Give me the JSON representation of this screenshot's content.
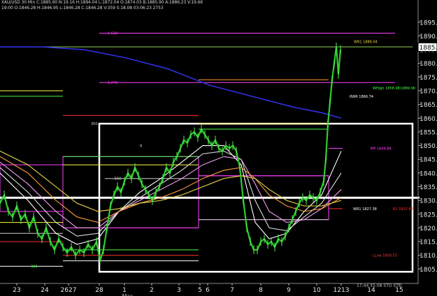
{
  "header": {
    "line1": "XAU/USD 30 Min  C:1885.90  N:19.16  H:1894.04  L:1872.04  O:1874.03  B:1885.90  A:1886.23  V:19.6K",
    "line2": "19:00  O:1846.28  H:1846.95  L:1846.28  C:1846.28  V:359  S:18.08  03:06:23  2753"
  },
  "chart_data": {
    "type": "line",
    "title": "XAU/USD 30 Min",
    "xlabel": "",
    "ylabel": "",
    "ylim": [
      1800,
      1898
    ],
    "grid": false,
    "x_ticks": [
      {
        "label": "23",
        "pos": 24
      },
      {
        "label": "24",
        "pos": 64
      },
      {
        "label": "2627",
        "pos": 98
      },
      {
        "label": "28",
        "pos": 142
      },
      {
        "label": "1",
        "pos": 178
      },
      {
        "label": "2",
        "pos": 217
      },
      {
        "label": "3",
        "pos": 256
      },
      {
        "label": "5",
        "pos": 286
      },
      {
        "label": "6",
        "pos": 297
      },
      {
        "label": "7",
        "pos": 332
      },
      {
        "label": "8",
        "pos": 373
      },
      {
        "label": "9",
        "pos": 413
      },
      {
        "label": "10",
        "pos": 453
      },
      {
        "label": "1213",
        "pos": 488
      },
      {
        "label": "14",
        "pos": 531
      },
      {
        "label": "15",
        "pos": 571
      }
    ],
    "x_sublabel": "Mar",
    "y_ticks": [
      1805,
      1810,
      1815,
      1820,
      1825,
      1830,
      1835,
      1840,
      1845,
      1850,
      1855,
      1860,
      1865,
      1870,
      1875,
      1880,
      1885,
      1890,
      1895
    ],
    "last_price_label": "1885.90",
    "price_series": [
      [
        0,
        1829
      ],
      [
        6,
        1832
      ],
      [
        12,
        1826
      ],
      [
        18,
        1824
      ],
      [
        24,
        1828
      ],
      [
        30,
        1823
      ],
      [
        36,
        1825
      ],
      [
        42,
        1820
      ],
      [
        48,
        1824
      ],
      [
        54,
        1818
      ],
      [
        60,
        1816
      ],
      [
        66,
        1820
      ],
      [
        72,
        1815
      ],
      [
        78,
        1812
      ],
      [
        84,
        1816
      ],
      [
        90,
        1813
      ],
      [
        96,
        1811
      ],
      [
        102,
        1813
      ],
      [
        108,
        1810
      ],
      [
        114,
        1812
      ],
      [
        120,
        1811
      ],
      [
        126,
        1814
      ],
      [
        132,
        1812
      ],
      [
        138,
        1815
      ],
      [
        143,
        1808
      ],
      [
        148,
        1812
      ],
      [
        153,
        1820
      ],
      [
        158,
        1828
      ],
      [
        163,
        1832
      ],
      [
        168,
        1835
      ],
      [
        173,
        1833
      ],
      [
        178,
        1837
      ],
      [
        183,
        1840
      ],
      [
        188,
        1838
      ],
      [
        193,
        1842
      ],
      [
        198,
        1839
      ],
      [
        203,
        1836
      ],
      [
        208,
        1834
      ],
      [
        213,
        1832
      ],
      [
        218,
        1830
      ],
      [
        223,
        1833
      ],
      [
        228,
        1835
      ],
      [
        233,
        1838
      ],
      [
        238,
        1842
      ],
      [
        243,
        1840
      ],
      [
        248,
        1844
      ],
      [
        253,
        1846
      ],
      [
        258,
        1849
      ],
      [
        263,
        1852
      ],
      [
        268,
        1851
      ],
      [
        273,
        1854
      ],
      [
        278,
        1855
      ],
      [
        283,
        1853
      ],
      [
        288,
        1856
      ],
      [
        293,
        1854
      ],
      [
        298,
        1852
      ],
      [
        303,
        1850
      ],
      [
        308,
        1852
      ],
      [
        313,
        1849
      ],
      [
        318,
        1848
      ],
      [
        323,
        1850
      ],
      [
        328,
        1849
      ],
      [
        333,
        1850
      ],
      [
        338,
        1848
      ],
      [
        343,
        1842
      ],
      [
        348,
        1830
      ],
      [
        353,
        1820
      ],
      [
        358,
        1815
      ],
      [
        363,
        1812
      ],
      [
        368,
        1812
      ],
      [
        373,
        1815
      ],
      [
        378,
        1816
      ],
      [
        383,
        1814
      ],
      [
        388,
        1815
      ],
      [
        393,
        1813
      ],
      [
        398,
        1816
      ],
      [
        403,
        1815
      ],
      [
        408,
        1817
      ],
      [
        413,
        1820
      ],
      [
        418,
        1823
      ],
      [
        423,
        1826
      ],
      [
        428,
        1829
      ],
      [
        433,
        1831
      ],
      [
        438,
        1830
      ],
      [
        443,
        1832
      ],
      [
        448,
        1831
      ],
      [
        453,
        1830
      ],
      [
        458,
        1833
      ],
      [
        463,
        1837
      ],
      [
        466,
        1845
      ],
      [
        469,
        1858
      ],
      [
        472,
        1866
      ],
      [
        475,
        1874
      ],
      [
        478,
        1880
      ],
      [
        481,
        1886
      ],
      [
        484,
        1876
      ],
      [
        487,
        1885
      ]
    ],
    "moving_averages": [
      {
        "color": "#ffffff",
        "points": [
          [
            0,
            1840
          ],
          [
            40,
            1830
          ],
          [
            80,
            1818
          ],
          [
            110,
            1814
          ],
          [
            140,
            1816
          ],
          [
            170,
            1826
          ],
          [
            200,
            1833
          ],
          [
            230,
            1838
          ],
          [
            260,
            1844
          ],
          [
            290,
            1850
          ],
          [
            320,
            1850
          ],
          [
            345,
            1843
          ],
          [
            365,
            1822
          ],
          [
            385,
            1816
          ],
          [
            410,
            1818
          ],
          [
            435,
            1826
          ],
          [
            460,
            1832
          ],
          [
            488,
            1848
          ]
        ]
      },
      {
        "color": "#dcdcdc",
        "points": [
          [
            0,
            1842
          ],
          [
            40,
            1833
          ],
          [
            80,
            1822
          ],
          [
            110,
            1817
          ],
          [
            140,
            1818
          ],
          [
            170,
            1826
          ],
          [
            200,
            1831
          ],
          [
            230,
            1836
          ],
          [
            260,
            1841
          ],
          [
            290,
            1847
          ],
          [
            320,
            1848
          ],
          [
            345,
            1845
          ],
          [
            365,
            1830
          ],
          [
            385,
            1820
          ],
          [
            410,
            1819
          ],
          [
            435,
            1824
          ],
          [
            460,
            1829
          ],
          [
            488,
            1840
          ]
        ]
      },
      {
        "color": "#f2a0f2",
        "points": [
          [
            0,
            1844
          ],
          [
            40,
            1836
          ],
          [
            80,
            1826
          ],
          [
            110,
            1820
          ],
          [
            140,
            1820
          ],
          [
            170,
            1826
          ],
          [
            200,
            1830
          ],
          [
            230,
            1834
          ],
          [
            260,
            1838
          ],
          [
            290,
            1843
          ],
          [
            320,
            1846
          ],
          [
            345,
            1845
          ],
          [
            365,
            1836
          ],
          [
            385,
            1826
          ],
          [
            410,
            1822
          ],
          [
            435,
            1823
          ],
          [
            460,
            1827
          ],
          [
            488,
            1834
          ]
        ]
      },
      {
        "color": "#ff9a40",
        "points": [
          [
            0,
            1846
          ],
          [
            40,
            1840
          ],
          [
            80,
            1830
          ],
          [
            110,
            1824
          ],
          [
            140,
            1822
          ],
          [
            170,
            1826
          ],
          [
            200,
            1829
          ],
          [
            230,
            1831
          ],
          [
            260,
            1834
          ],
          [
            290,
            1838
          ],
          [
            320,
            1841
          ],
          [
            345,
            1842
          ],
          [
            365,
            1838
          ],
          [
            385,
            1832
          ],
          [
            410,
            1828
          ],
          [
            435,
            1826
          ],
          [
            460,
            1827
          ],
          [
            488,
            1831
          ]
        ]
      },
      {
        "color": "#f0d848",
        "points": [
          [
            0,
            1848
          ],
          [
            40,
            1843
          ],
          [
            80,
            1835
          ],
          [
            110,
            1829
          ],
          [
            140,
            1826
          ],
          [
            170,
            1827
          ],
          [
            200,
            1829
          ],
          [
            230,
            1830
          ],
          [
            260,
            1832
          ],
          [
            290,
            1835
          ],
          [
            320,
            1838
          ],
          [
            345,
            1839
          ],
          [
            365,
            1838
          ],
          [
            385,
            1834
          ],
          [
            410,
            1830
          ],
          [
            435,
            1828
          ],
          [
            460,
            1828
          ],
          [
            488,
            1830
          ]
        ]
      },
      {
        "color": "#3030e0",
        "points": [
          [
            0,
            1886
          ],
          [
            60,
            1886
          ],
          [
            120,
            1885
          ],
          [
            180,
            1882
          ],
          [
            240,
            1878
          ],
          [
            300,
            1872
          ],
          [
            360,
            1868
          ],
          [
            420,
            1864
          ],
          [
            460,
            1862
          ],
          [
            488,
            1860
          ]
        ]
      }
    ],
    "level_lines": [
      {
        "y": 1891,
        "color": "#ff40ff",
        "x1": 142,
        "x2": 565,
        "label": "1.618",
        "label_pos": "left"
      },
      {
        "y": 1886,
        "color": "#90d050",
        "x1": 0,
        "x2": 590,
        "label": "",
        "label_pos": ""
      },
      {
        "y": 1873,
        "color": "#ff40ff",
        "x1": 142,
        "x2": 565,
        "label": "1.272",
        "label_pos": "left"
      },
      {
        "y": 1874,
        "color": "#ff9a20",
        "x1": 284,
        "x2": 470,
        "label": "",
        "label_pos": ""
      },
      {
        "y": 1870,
        "color": "#ffff40",
        "x1": 0,
        "x2": 90,
        "label": "",
        "label_pos": ""
      },
      {
        "y": 1868,
        "color": "#44ff44",
        "x1": 0,
        "x2": 90,
        "label": "",
        "label_pos": ""
      },
      {
        "y": 1861,
        "color": "#ff3030",
        "x1": 90,
        "x2": 284,
        "label": "",
        "label_pos": ""
      },
      {
        "y": 1858,
        "color": "#ffff40",
        "x1": 284,
        "x2": 470,
        "label": "",
        "label_pos": ""
      },
      {
        "y": 1856,
        "color": "#44ff44",
        "x1": 284,
        "x2": 470,
        "label": "",
        "label_pos": ""
      },
      {
        "y": 1849,
        "color": "#ff40ff",
        "x1": 470,
        "x2": 490,
        "label": "",
        "label_pos": ""
      },
      {
        "y": 1846,
        "color": "#44ff44",
        "x1": 90,
        "x2": 284,
        "label": "",
        "label_pos": ""
      },
      {
        "y": 1843,
        "color": "#ffff40",
        "x1": 90,
        "x2": 284,
        "label": "",
        "label_pos": ""
      },
      {
        "y": 1839,
        "color": "#ff40ff",
        "x1": 284,
        "x2": 470,
        "label": "",
        "label_pos": ""
      },
      {
        "y": 1838,
        "color": "#d0d0d0",
        "x1": 150,
        "x2": 284,
        "label": ".500",
        "label_pos": "left"
      },
      {
        "y": 1827,
        "color": "#ff3030",
        "x1": 470,
        "x2": 490,
        "label": "",
        "label_pos": ""
      },
      {
        "y": 1823,
        "color": "#d0d0d0",
        "x1": 284,
        "x2": 470,
        "label": "",
        "label_pos": ""
      },
      {
        "y": 1822,
        "color": "#ffff40",
        "x1": 0,
        "x2": 90,
        "label": "",
        "label_pos": ""
      },
      {
        "y": 1820,
        "color": "#ff40ff",
        "x1": 90,
        "x2": 284,
        "label": "",
        "label_pos": ""
      },
      {
        "y": 1818,
        "color": "#d0d0d0",
        "x1": 0,
        "x2": 90,
        "label": "",
        "label_pos": ""
      },
      {
        "y": 1815,
        "color": "#ff3030",
        "x1": 0,
        "x2": 90,
        "label": "",
        "label_pos": ""
      },
      {
        "y": 1812,
        "color": "#44ff44",
        "x1": 90,
        "x2": 284,
        "label": "",
        "label_pos": ""
      },
      {
        "y": 1810,
        "color": "#ff3030",
        "x1": 90,
        "x2": 284,
        "label": "",
        "label_pos": ""
      },
      {
        "y": 1808,
        "color": "#ffffff",
        "x1": 90,
        "x2": 284,
        "label": "",
        "label_pos": ""
      },
      {
        "y": 1806,
        "color": "#ffffff",
        "x1": 0,
        "x2": 90,
        "label": "",
        "label_pos": ""
      }
    ],
    "fib_levels": [
      {
        "label": ".500",
        "y": 1838
      },
      {
        "label": "1.000",
        "y": 1806
      }
    ],
    "pivot_labels": [
      {
        "text": "WR1  1886.04",
        "y": 1888,
        "color": "#f0d848",
        "x": 506
      },
      {
        "text": "WHigh 1858.98/1889.90",
        "y": 1871,
        "color": "#44ff44",
        "x": 533
      },
      {
        "text": "RWR  1866.74",
        "y": 1868,
        "color": "#ffffff",
        "x": 500
      },
      {
        "text": "MP  1849.88",
        "y": 1849,
        "color": "#ff40ff",
        "x": 530
      },
      {
        "text": "WR1  1827.38",
        "y": 1827,
        "color": "#ffffff",
        "x": 505
      },
      {
        "text": "R1  1827.83",
        "y": 1827,
        "color": "#ff3030",
        "x": 562
      },
      {
        "text": "LLow 1809.55",
        "y": 1810,
        "color": "#ff3030",
        "x": 533
      }
    ],
    "mini_labels": [
      {
        "text": "300",
        "y": 1858,
        "x": 130,
        "color": "#d0d0d0"
      },
      {
        "text": "8",
        "y": 1850,
        "x": 200,
        "color": "#d0d0d0"
      },
      {
        "text": "300",
        "y": 1806,
        "x": 44,
        "color": "#44ff44"
      }
    ],
    "rectangles": [
      {
        "x1": 142,
        "x2": 590,
        "y_top": 1858,
        "y_bottom": 1804,
        "color": "#ffffff"
      },
      {
        "x1": 0,
        "x2": 90,
        "y_top": 1843,
        "y_bottom": 1826,
        "color": "#ff40ff"
      },
      {
        "x1": 90,
        "x2": 284,
        "y_top": 1846,
        "y_bottom": 1820,
        "color": "#ff40ff"
      },
      {
        "x1": 284,
        "x2": 470,
        "y_top": 1839,
        "y_bottom": 1823,
        "color": "#ff40ff"
      }
    ],
    "horizontal_band": {
      "y": 1831,
      "x1": 0,
      "x2": 600,
      "color": "#ffffff"
    },
    "bottom_right_text": "17:44  15:08  STO  STO"
  }
}
